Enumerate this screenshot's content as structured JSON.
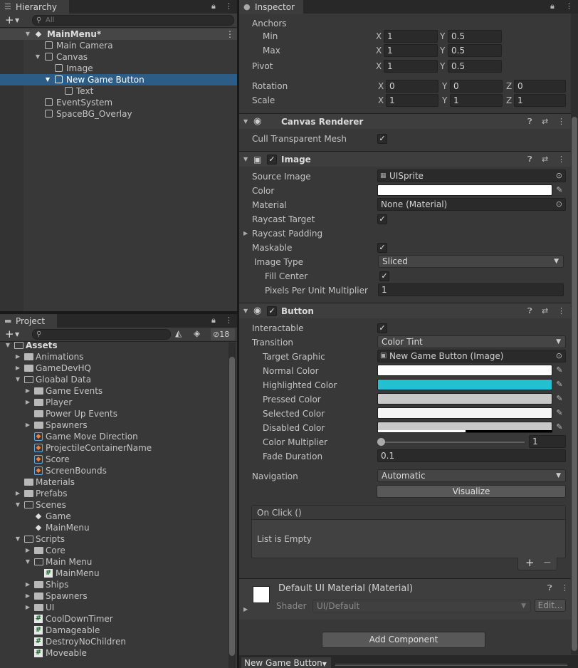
{
  "hierarchy": {
    "tab_label": "Hierarchy",
    "search_placeholder": "All",
    "items": [
      {
        "label": "MainMenu*"
      },
      {
        "label": "Main Camera"
      },
      {
        "label": "Canvas"
      },
      {
        "label": "Image"
      },
      {
        "label": "New Game Button"
      },
      {
        "label": "Text"
      },
      {
        "label": "EventSystem"
      },
      {
        "label": "SpaceBG_Overlay"
      }
    ]
  },
  "project": {
    "tab_label": "Project",
    "visible_count": "18",
    "items": [
      {
        "label": "Assets"
      },
      {
        "label": "Animations"
      },
      {
        "label": "GameDevHQ"
      },
      {
        "label": "Gloabal Data"
      },
      {
        "label": "Game Events"
      },
      {
        "label": "Player"
      },
      {
        "label": "Power Up Events"
      },
      {
        "label": "Spawners"
      },
      {
        "label": "Game Move Direction"
      },
      {
        "label": "ProjectileContainerName"
      },
      {
        "label": "Score"
      },
      {
        "label": "ScreenBounds"
      },
      {
        "label": "Materials"
      },
      {
        "label": "Prefabs"
      },
      {
        "label": "Scenes"
      },
      {
        "label": "Game"
      },
      {
        "label": "MainMenu"
      },
      {
        "label": "Scripts"
      },
      {
        "label": "Core"
      },
      {
        "label": "Main Menu"
      },
      {
        "label": "MainMenu"
      },
      {
        "label": "Ships"
      },
      {
        "label": "Spawners"
      },
      {
        "label": "UI"
      },
      {
        "label": "CoolDownTimer"
      },
      {
        "label": "Damageable"
      },
      {
        "label": "DestroyNoChildren"
      },
      {
        "label": "Moveable"
      }
    ]
  },
  "inspector": {
    "tab_label": "Inspector",
    "rect_transform": {
      "anchors_label": "Anchors",
      "min_label": "Min",
      "min_x": "1",
      "min_y": "0.5",
      "max_label": "Max",
      "max_x": "1",
      "max_y": "0.5",
      "pivot_label": "Pivot",
      "pivot_x": "1",
      "pivot_y": "0.5",
      "rotation_label": "Rotation",
      "rot_x": "0",
      "rot_y": "0",
      "rot_z": "0",
      "scale_label": "Scale",
      "scale_x": "1",
      "scale_y": "1",
      "scale_z": "1",
      "axis_x": "X",
      "axis_y": "Y",
      "axis_z": "Z"
    },
    "canvas_renderer": {
      "title": "Canvas Renderer",
      "cull_label": "Cull Transparent Mesh"
    },
    "image": {
      "title": "Image",
      "source_label": "Source Image",
      "source_value": "UISprite",
      "color_label": "Color",
      "color_value": "#ffffff",
      "material_label": "Material",
      "material_value": "None (Material)",
      "raycast_target_label": "Raycast Target",
      "raycast_padding_label": "Raycast Padding",
      "maskable_label": "Maskable",
      "image_type_label": "Image Type",
      "image_type_value": "Sliced",
      "fill_center_label": "Fill Center",
      "ppu_label": "Pixels Per Unit Multiplier",
      "ppu_value": "1"
    },
    "button": {
      "title": "Button",
      "interactable_label": "Interactable",
      "transition_label": "Transition",
      "transition_value": "Color Tint",
      "target_graphic_label": "Target Graphic",
      "target_graphic_value": "New Game Button (Image)",
      "normal_label": "Normal Color",
      "normal_color": "#ffffff",
      "highlighted_label": "Highlighted Color",
      "highlighted_color": "#22c0d0",
      "pressed_label": "Pressed Color",
      "pressed_color": "#c8c8c8",
      "selected_label": "Selected Color",
      "selected_color": "#f5f5f5",
      "disabled_label": "Disabled Color",
      "disabled_color": "#c8c8c8",
      "multiplier_label": "Color Multiplier",
      "multiplier_value": "1",
      "fade_label": "Fade Duration",
      "fade_value": "0.1",
      "navigation_label": "Navigation",
      "navigation_value": "Automatic",
      "visualize_label": "Visualize",
      "onclick_label": "On Click ()",
      "list_empty_label": "List is Empty",
      "add_label": "+",
      "remove_label": "−"
    },
    "material": {
      "title": "Default UI Material (Material)",
      "shader_label": "Shader",
      "shader_value": "UI/Default",
      "edit_label": "Edit..."
    },
    "add_component_label": "Add Component",
    "bottom_tab_label": "New Game Button"
  },
  "colors": {
    "selection": "#2c5d87",
    "accent_cyan": "#22c0d0"
  }
}
